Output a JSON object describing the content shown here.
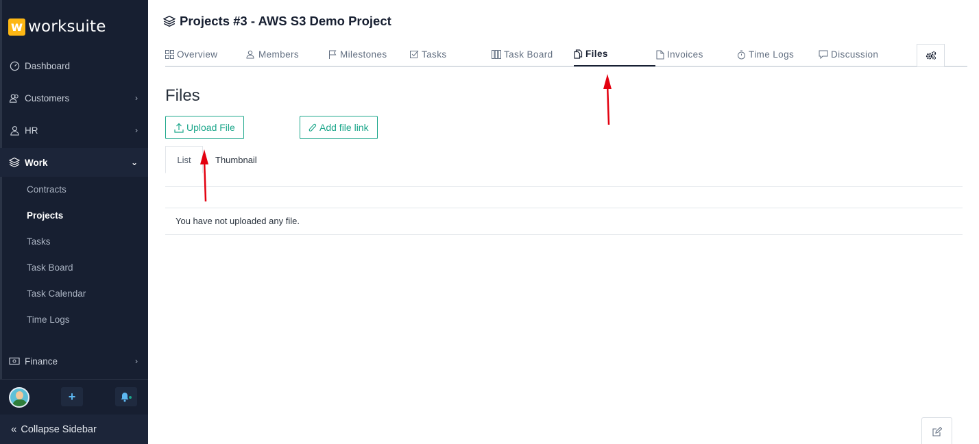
{
  "brand": {
    "mark": "w",
    "name": "worksuite"
  },
  "sidebar": {
    "items": [
      {
        "label": "Dashboard",
        "icon": "speedometer-icon"
      },
      {
        "label": "Customers",
        "icon": "user-group-icon"
      },
      {
        "label": "HR",
        "icon": "person-icon"
      },
      {
        "label": "Work",
        "icon": "layers-icon"
      },
      {
        "label": "Finance",
        "icon": "cash-icon"
      }
    ],
    "work_sub": [
      "Contracts",
      "Projects",
      "Tasks",
      "Task Board",
      "Task Calendar",
      "Time Logs"
    ],
    "collapse_label": "Collapse Sidebar"
  },
  "page": {
    "title": "Projects #3 - AWS S3 Demo Project"
  },
  "tabs": [
    "Overview",
    "Members",
    "Milestones",
    "Tasks",
    "Task Board",
    "Files",
    "Invoices",
    "Time Logs",
    "Discussion"
  ],
  "files": {
    "heading": "Files",
    "upload_label": "Upload File",
    "add_link_label": "Add file link",
    "view_list": "List",
    "view_thumbnail": "Thumbnail",
    "empty_message": "You have not uploaded any file."
  },
  "colors": {
    "sidebar": "#171f31",
    "accent": "#1ba68a",
    "brand": "#fdb714",
    "annotation": "#e3000f"
  }
}
